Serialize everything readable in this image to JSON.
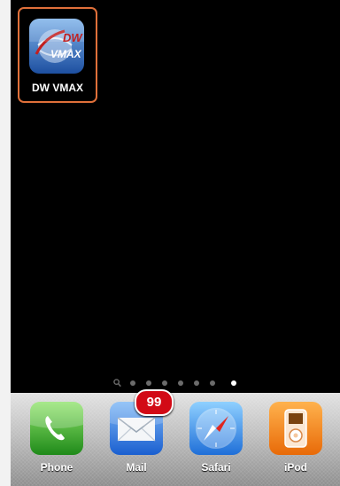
{
  "home_screen": {
    "apps": [
      {
        "label": "DW VMAX",
        "icon": "dw-vmax-app-icon",
        "icon_text_top": "DW",
        "icon_text_bottom": "VMAX",
        "highlight_color": "#e0703a"
      }
    ],
    "page_indicator": {
      "pages": 8,
      "current_page": 8,
      "first_is_search": true
    }
  },
  "dock": {
    "items": [
      {
        "label": "Phone",
        "icon": "phone-icon"
      },
      {
        "label": "Mail",
        "icon": "mail-icon",
        "badge": "99"
      },
      {
        "label": "Safari",
        "icon": "safari-compass-icon"
      },
      {
        "label": "iPod",
        "icon": "ipod-icon"
      }
    ]
  }
}
